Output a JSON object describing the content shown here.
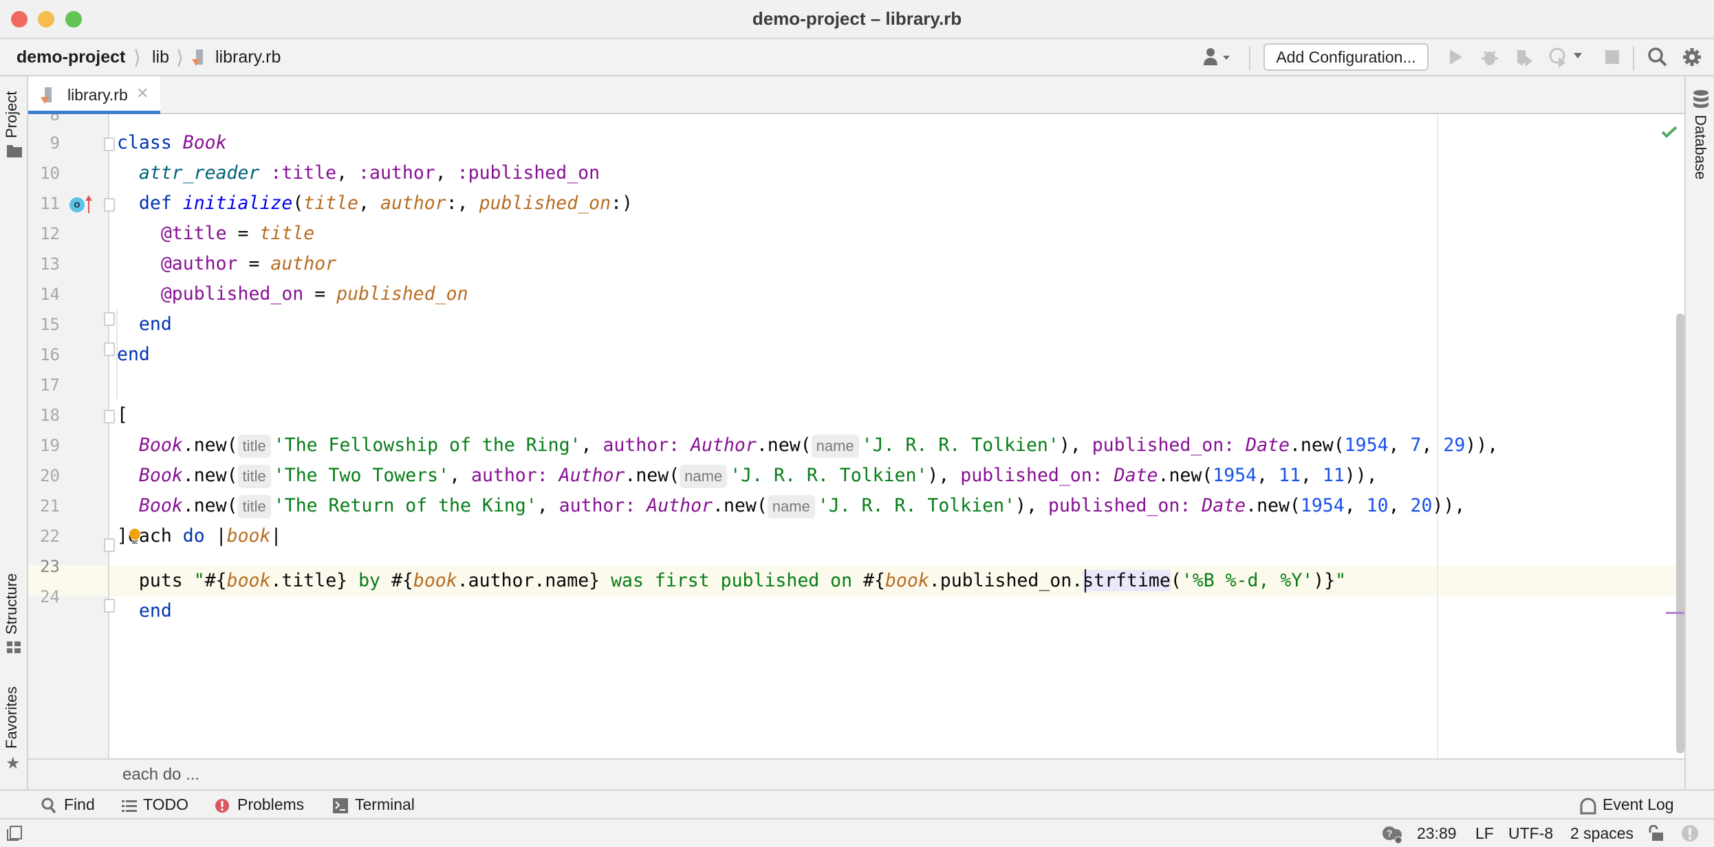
{
  "window": {
    "title": "demo-project – library.rb",
    "traffic_colors": {
      "close": "#ee6a5f",
      "minimize": "#f5bd4f",
      "zoom": "#61c454"
    }
  },
  "navbar": {
    "breadcrumb": [
      "demo-project",
      "lib",
      "library.rb"
    ],
    "separator": "⟩",
    "add_configuration": "Add Configuration...",
    "icons": [
      "user-vcs-icon",
      "run-icon",
      "debug-icon",
      "coverage-icon",
      "profile-icon",
      "stop-icon",
      "search-icon",
      "settings-icon"
    ]
  },
  "left_tools": {
    "project": "Project",
    "structure": "Structure",
    "favorites": "Favorites"
  },
  "right_tools": {
    "database": "Database"
  },
  "tabs": [
    {
      "label": "library.rb",
      "active": true,
      "close": "✕"
    }
  ],
  "editor": {
    "first_partial_line": "8",
    "line_numbers": [
      "9",
      "10",
      "11",
      "12",
      "13",
      "14",
      "15",
      "16",
      "17",
      "18",
      "19",
      "20",
      "21",
      "22",
      "23",
      "24"
    ],
    "current_line": "23",
    "hint_title": "title",
    "hint_name": "name",
    "tokens": {
      "class": "class",
      "Book": "Book",
      "attr_reader": "attr_reader",
      "sym_title": ":title",
      "sym_author": ":author",
      "sym_published_on": ":published_on",
      "def": "def",
      "initialize": "initialize",
      "p_title": "title",
      "p_author": "author",
      "p_published_on": "published_on",
      "ivar_title": "@title",
      "ivar_author": "@author",
      "ivar_published_on": "@published_on",
      "end": "end",
      "open_bracket": "[",
      "close_bracket": "]",
      "new": ".new(",
      "author_kw": "author:",
      "published_on_kw": "published_on:",
      "Author": "Author",
      "Date": "Date",
      "tolkien": "'J. R. R. Tolkien'",
      "each": "each",
      "do": "do",
      "book": "book",
      "puts": "puts"
    },
    "books": [
      {
        "title": "'The Fellowship of the Ring'",
        "year": "1954",
        "month": "7",
        "day": "29",
        "tail": ")),"
      },
      {
        "title": "'The Two Towers'",
        "year": "1954",
        "month": "11",
        "day": "11",
        "tail": ")),"
      },
      {
        "title": "'The Return of the King'",
        "year": "1954",
        "month": "10",
        "day": "20",
        "tail": ")),"
      }
    ],
    "line23": {
      "q_open": "\"#{",
      "b1": "book",
      "t1": ".title",
      "c1": "}",
      "s1": " by ",
      "o2": "#{",
      "b2": "book",
      "t2": ".author.name",
      "c2": "}",
      "s2": " was first published on ",
      "o3": "#{",
      "b3": "book",
      "t3": ".published_on.",
      "strf": "strftime",
      "paren": "(",
      "fmt": "'%B %-d, %Y'",
      "close": ")}",
      "q_close": "\""
    },
    "inspection_status": "ok"
  },
  "editor_breadcrumb": "each do ...",
  "tool_windows": [
    {
      "label": "Find",
      "icon": "search-icon"
    },
    {
      "label": "TODO",
      "icon": "list-icon"
    },
    {
      "label": "Problems",
      "icon": "problems-icon"
    },
    {
      "label": "Terminal",
      "icon": "terminal-icon"
    }
  ],
  "event_log": "Event Log",
  "status": {
    "position": "23:89",
    "line_separator": "LF",
    "encoding": "UTF-8",
    "indent": "2 spaces"
  }
}
